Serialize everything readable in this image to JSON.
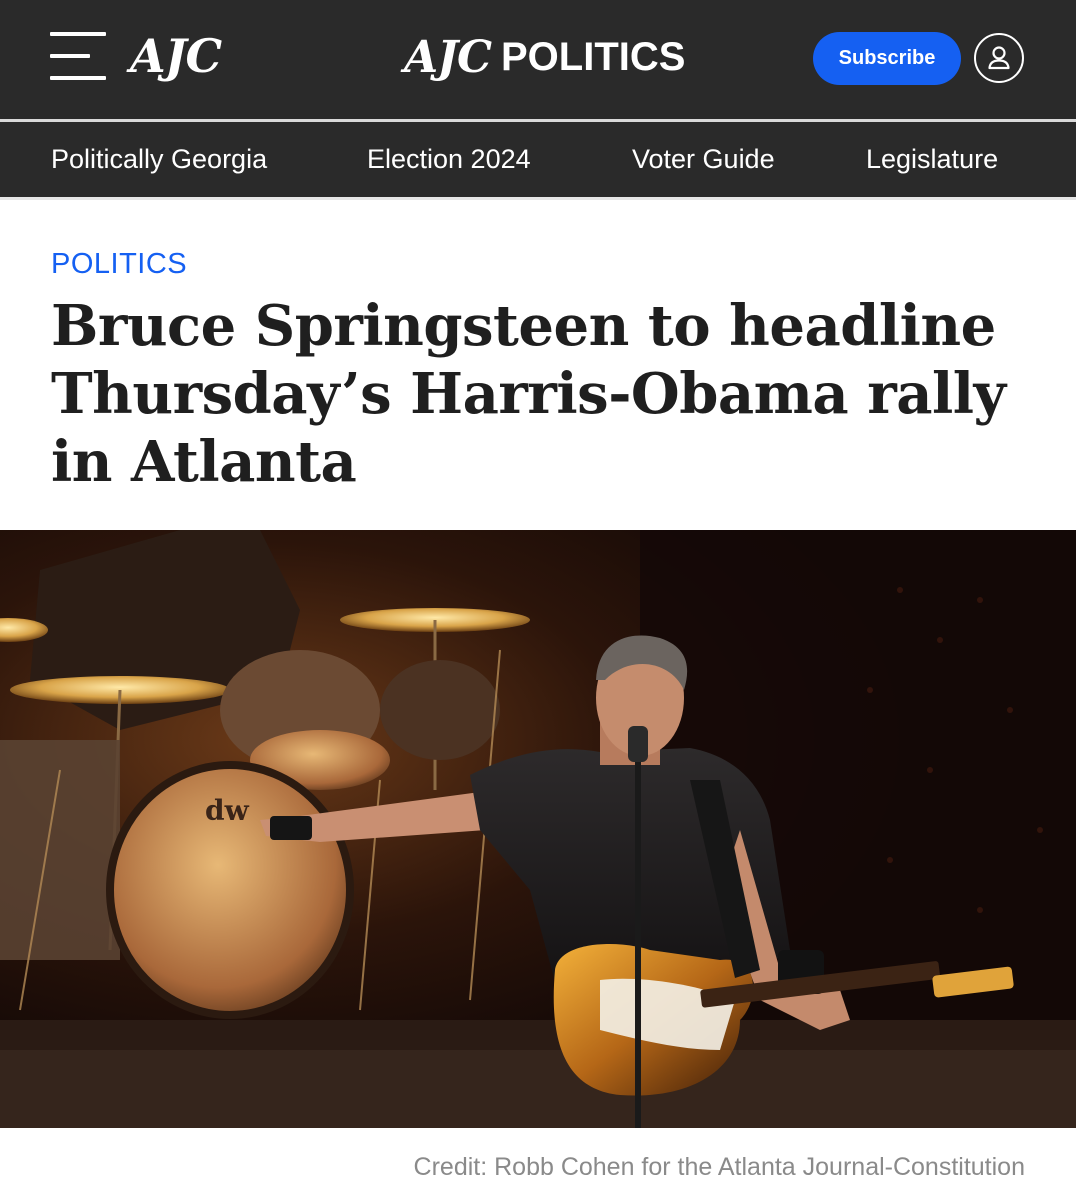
{
  "header": {
    "logo_small": "AJC",
    "logo_center_mark": "AJC",
    "logo_center_section": "POLITICS",
    "subscribe_label": "Subscribe",
    "brand_color": "#1560f2",
    "background": "#2a2a2a"
  },
  "nav": {
    "items": [
      {
        "label": "Politically Georgia"
      },
      {
        "label": "Election 2024"
      },
      {
        "label": "Voter Guide"
      },
      {
        "label": "Legislature"
      }
    ]
  },
  "article": {
    "kicker": "POLITICS",
    "headline": "Bruce Springsteen to headline Thursday’s Harris-Obama rally in Atlanta",
    "photo_credit": "Credit: Robb Cohen for the Atlanta Journal-Constitution"
  },
  "icons": {
    "menu": "hamburger-menu-icon",
    "account": "user-account-icon"
  }
}
